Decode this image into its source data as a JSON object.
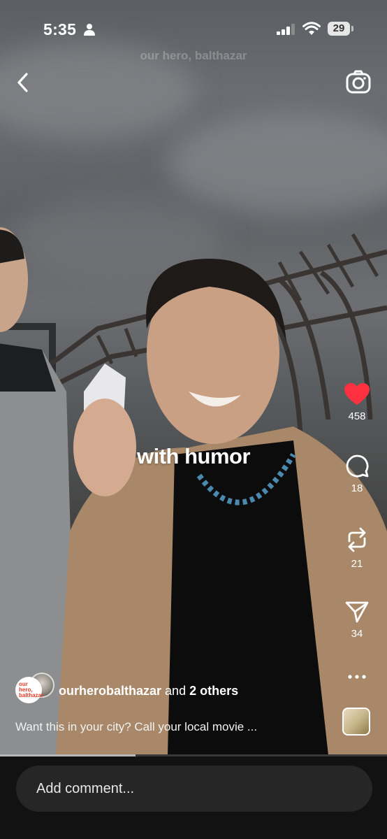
{
  "status_bar": {
    "time": "5:35",
    "battery": "29"
  },
  "header": {
    "watermark": "our hero, balthazar",
    "back_icon": "chevron-left-icon",
    "camera_icon": "camera-icon"
  },
  "video": {
    "caption_overlay": "with humor",
    "progress": 0.35
  },
  "actions": {
    "like_count": "458",
    "comment_count": "18",
    "repost_count": "21",
    "share_count": "34",
    "like_color": "#ff3040"
  },
  "post": {
    "avatar_text": "our hero, balthazar",
    "author": "ourherobalthazar",
    "conjunction": "and",
    "others": "2 others",
    "description": "Want this in your city? Call your local movie ..."
  },
  "comment": {
    "placeholder": "Add comment..."
  }
}
